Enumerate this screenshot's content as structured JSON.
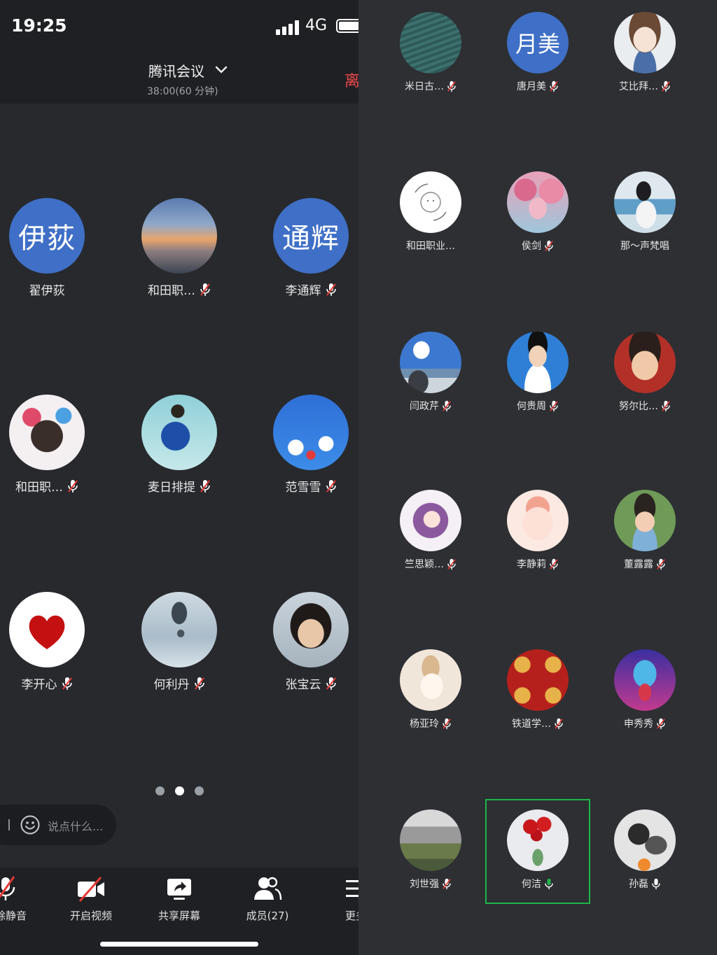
{
  "status_bar": {
    "time": "19:25",
    "network": "4G"
  },
  "meeting": {
    "title": "腾讯会议",
    "time": "38:00(60 分钟)",
    "leave_label": "离"
  },
  "left_participants": [
    {
      "name": "翟伊荻",
      "avatar_text": "伊荻",
      "muted": false
    },
    {
      "name": "和田职…",
      "muted": true
    },
    {
      "name": "李通辉",
      "avatar_text": "通辉",
      "muted": true
    },
    {
      "name": "和田职…",
      "muted": true
    },
    {
      "name": "麦日排提",
      "muted": true
    },
    {
      "name": "范雪雪",
      "muted": true
    },
    {
      "name": "李开心",
      "muted": true
    },
    {
      "name": "何利丹",
      "muted": true
    },
    {
      "name": "张宝云",
      "muted": true
    }
  ],
  "chat": {
    "placeholder": "说点什么..."
  },
  "toolbar": {
    "mute_label": "解除静音",
    "video_label": "开启视频",
    "share_label": "共享屏幕",
    "members_label": "成员(27)",
    "more_label": "更多"
  },
  "right_participants": [
    {
      "name": "米日古…",
      "muted": true
    },
    {
      "name": "唐月美",
      "avatar_text": "月美",
      "muted": true
    },
    {
      "name": "艾比拜…",
      "muted": true
    },
    {
      "name": "和田职业…",
      "muted": false
    },
    {
      "name": "侯剑",
      "muted": true
    },
    {
      "name": "那～声梵唱",
      "muted": false
    },
    {
      "name": "闫政芹",
      "muted": true
    },
    {
      "name": "何贵周",
      "muted": true
    },
    {
      "name": "努尔比…",
      "muted": true
    },
    {
      "name": "竺思颖…",
      "muted": true
    },
    {
      "name": "李静莉",
      "muted": true
    },
    {
      "name": "董露露",
      "muted": true
    },
    {
      "name": "杨亚玲",
      "muted": true
    },
    {
      "name": "铁道学…",
      "muted": true
    },
    {
      "name": "申秀秀",
      "muted": true
    },
    {
      "name": "刘世强",
      "muted": true
    },
    {
      "name": "何洁",
      "muted": false,
      "speaking": true
    },
    {
      "name": "孙磊",
      "muted": false,
      "host": true
    }
  ],
  "colors": {
    "accent_blue": "#3f6fc6",
    "speaking_green": "#1fb54b",
    "leave_red": "#f04a4a"
  }
}
